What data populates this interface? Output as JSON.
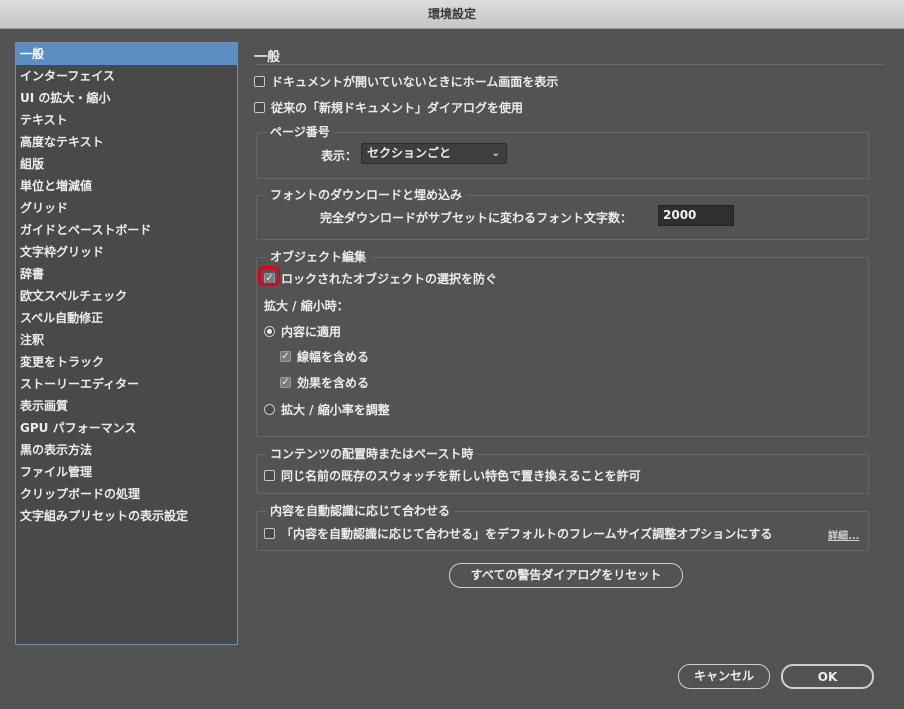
{
  "window": {
    "title": "環境設定"
  },
  "sidebar": {
    "items": [
      {
        "label": "一般",
        "selected": true
      },
      {
        "label": "インターフェイス"
      },
      {
        "label": "UI の拡大・縮小"
      },
      {
        "label": "テキスト"
      },
      {
        "label": "高度なテキスト"
      },
      {
        "label": "組版"
      },
      {
        "label": "単位と増減値"
      },
      {
        "label": "グリッド"
      },
      {
        "label": "ガイドとペーストボード"
      },
      {
        "label": "文字枠グリッド"
      },
      {
        "label": "辞書"
      },
      {
        "label": "欧文スペルチェック"
      },
      {
        "label": "スペル自動修正"
      },
      {
        "label": "注釈"
      },
      {
        "label": "変更をトラック"
      },
      {
        "label": "ストーリーエディター"
      },
      {
        "label": "表示画質"
      },
      {
        "label": "GPU パフォーマンス"
      },
      {
        "label": "黒の表示方法"
      },
      {
        "label": "ファイル管理"
      },
      {
        "label": "クリップボードの処理"
      },
      {
        "label": "文字組みプリセットの表示設定"
      }
    ]
  },
  "main": {
    "heading": "一般",
    "show_home": {
      "label": "ドキュメントが開いていないときにホーム画面を表示",
      "checked": false
    },
    "legacy_new_doc": {
      "label": "従来の「新規ドキュメント」ダイアログを使用",
      "checked": false
    },
    "page_numbering": {
      "title": "ページ番号",
      "view_label": "表示：",
      "view_value": "セクションごと"
    },
    "font_download": {
      "title": "フォントのダウンロードと埋め込み",
      "label": "完全ダウンロードがサブセットに変わるフォント文字数：",
      "value": "2000"
    },
    "object_editing": {
      "title": "オブジェクト編集",
      "prevent_locked": {
        "label": "ロックされたオブジェクトの選択を防ぐ",
        "checked": true
      },
      "scaling_label": "拡大 / 縮小時：",
      "apply_content": {
        "label": "内容に適用",
        "selected": true
      },
      "include_stroke": {
        "label": "線幅を含める",
        "checked": true
      },
      "include_effects": {
        "label": "効果を含める",
        "checked": true
      },
      "adjust_percentage": {
        "label": "拡大 / 縮小率を調整",
        "selected": false
      }
    },
    "paste": {
      "title": "コンテンツの配置時またはペースト時",
      "replace_swatch": {
        "label": "同じ名前の既存のスウォッチを新しい特色で置き換えることを許可",
        "checked": false
      }
    },
    "content_aware": {
      "title": "内容を自動認識に応じて合わせる",
      "default_option": {
        "label": "「内容を自動認識に応じて合わせる」をデフォルトのフレームサイズ調整オプションにする",
        "checked": false
      },
      "details_link": "詳細..."
    },
    "reset_button": "すべての警告ダイアログをリセット"
  },
  "footer": {
    "cancel": "キャンセル",
    "ok": "OK"
  },
  "colors": {
    "background": "#535353",
    "selection": "#5b8ec2",
    "highlight": "#e3001b"
  }
}
